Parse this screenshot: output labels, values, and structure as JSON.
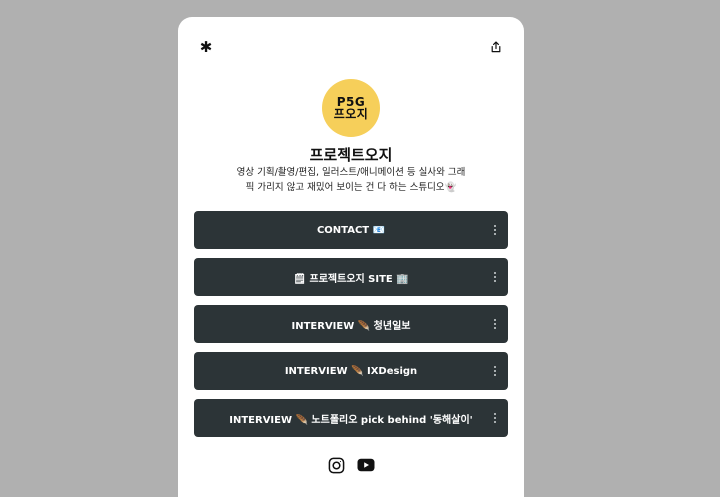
{
  "profile": {
    "avatar_lines": [
      "P5G",
      "프오지"
    ],
    "name": "프로젝트오지",
    "description": "영상 기획/촬영/편집, 일러스트/애니메이션 등 실사와 그래픽 가리지 않고 재밌어 보이는 건 다 하는 스튜디오👻"
  },
  "links": [
    {
      "label": "CONTACT 📧"
    },
    {
      "label": "🗒 프로젝트오지 SITE 🏢"
    },
    {
      "label": "INTERVIEW 🪶 청년일보"
    },
    {
      "label": "INTERVIEW 🪶 IXDesign"
    },
    {
      "label": "INTERVIEW 🪶 노트폴리오 pick behind '동해살이'"
    }
  ],
  "icons": {
    "top_left": "linktree-logo-icon",
    "top_right": "share-icon",
    "link_menu": "kebab-menu-icon",
    "socials": [
      "instagram-icon",
      "youtube-icon"
    ]
  },
  "colors": {
    "background": "#b0b0b0",
    "card": "#ffffff",
    "button": "#2c3437",
    "button_text": "#ffffff",
    "avatar": "#f6cf5a"
  }
}
